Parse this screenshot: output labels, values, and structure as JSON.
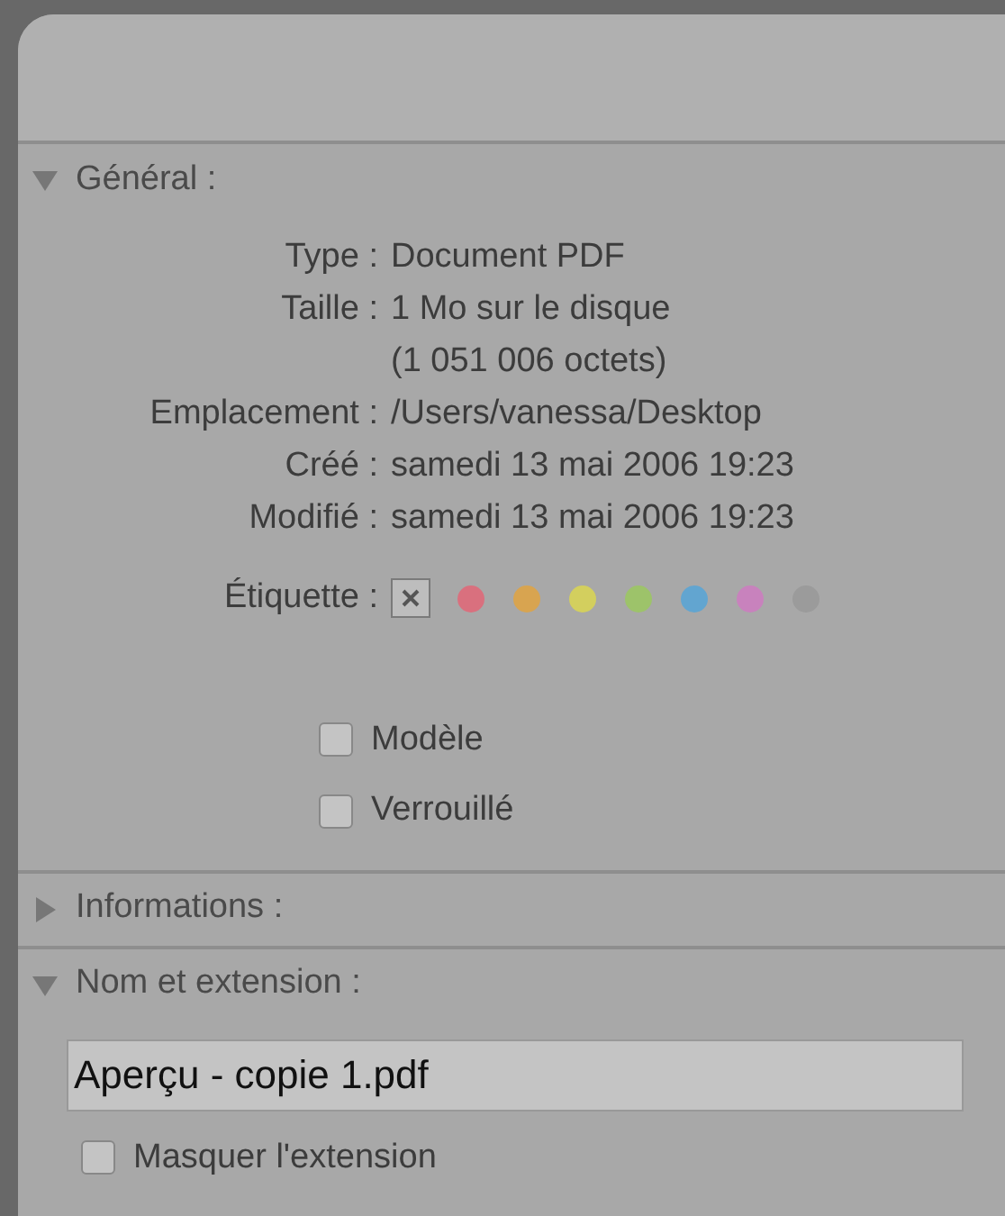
{
  "general": {
    "title": "Général :",
    "expanded": true,
    "rows": [
      {
        "label": "Type :",
        "lines": [
          "Document PDF"
        ]
      },
      {
        "label": "Taille :",
        "lines": [
          "1 Mo sur le disque",
          "(1 051 006 octets)"
        ]
      },
      {
        "label": "Emplacement :",
        "lines": [
          "/Users/vanessa/Desktop"
        ]
      },
      {
        "label": "Créé :",
        "lines": [
          "samedi 13 mai 2006 19:23"
        ]
      },
      {
        "label": "Modifié :",
        "lines": [
          "samedi 13 mai 2006 19:23"
        ]
      }
    ],
    "label_row": {
      "label": "Étiquette :",
      "colors": [
        {
          "color": "#d9707e"
        },
        {
          "color": "#d8a450"
        },
        {
          "color": "#d3cf5e"
        },
        {
          "color": "#9dc36a"
        },
        {
          "color": "#62a5d0"
        },
        {
          "color": "#c882bd"
        },
        {
          "color": "#9b9b9b"
        }
      ]
    },
    "checkboxes": [
      {
        "label": "Modèle",
        "checked": false
      },
      {
        "label": "Verrouillé",
        "checked": false
      }
    ]
  },
  "informations": {
    "title": "Informations :",
    "expanded": false
  },
  "name_extension": {
    "title": "Nom et extension :",
    "expanded": true,
    "value": "Aperçu - copie 1.pdf",
    "checkboxes": [
      {
        "label": "Masquer l'extension",
        "checked": false
      }
    ]
  }
}
